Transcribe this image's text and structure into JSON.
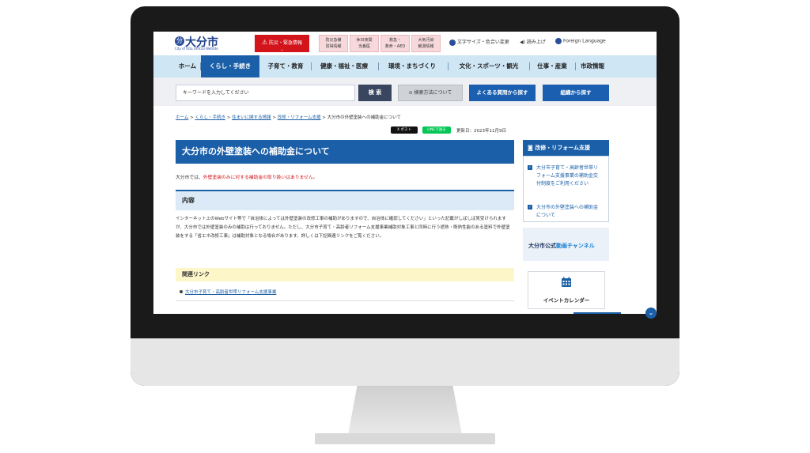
{
  "header": {
    "logo_mark": "分",
    "site_name": "大分市",
    "site_sub": "City of Oita Official Website",
    "alert_label": "防災・緊急情報",
    "alert_chevron": "⌄",
    "pink_buttons": [
      {
        "line1": "防災急備",
        "line2": "習得情報"
      },
      {
        "line1": "休日夜間",
        "line2": "当番医"
      },
      {
        "line1": "救急・",
        "line2": "救命・AED"
      },
      {
        "line1": "大気汚染",
        "line2": "観測情報"
      }
    ],
    "util_links": {
      "text_size": "文字サイズ・色合い変更",
      "read_aloud": "読み上げ",
      "language": "Foreign Language"
    }
  },
  "nav": {
    "items": [
      "ホーム",
      "くらし・手続き",
      "子育て・教育",
      "健康・福祉・医療",
      "環境・まちづくり",
      "文化・スポーツ・観光",
      "仕事・産業",
      "市政情報"
    ],
    "active_index": 1
  },
  "search": {
    "placeholder": "キーワードを入力してください",
    "search_button": "検 索",
    "how_to_button": "⊙ 検索方法について",
    "faq_button": "よくある質問から探す",
    "org_button": "組織から探す"
  },
  "breadcrumb": {
    "items": [
      "ホーム",
      "くらし・手続き",
      "住まいに関する情報",
      "改修・リフォーム支援"
    ],
    "current": "大分市の外壁塗装への補助金について",
    "separator": " > "
  },
  "share": {
    "x_post": "X ポスト",
    "line_send": "LINEで送る",
    "updated": "更新日：2023年11月9日"
  },
  "page": {
    "title": "大分市の外壁塗装への補助金について",
    "note_prefix": "大分市では、",
    "note_red": "外壁塗装のみに対する補助金の取り扱いはありません。",
    "section_heading": "内容",
    "body": "インターネット上のWebサイト等で「自治体によっては外壁塗装の改修工事の補助がありますので、自治体に確認してください」といった記載がしばしば見受けられますが、大分市では外壁塗装のみの補助は行っておりません。ただし、大分市子育て・高齢者リフォーム支援事業補助対象工事と同時に行う遮熱・断熱性能のある塗料で外壁塗装をする「省エネ改修工事」は補助対象となる場合があります。詳しくは下記関連リンクをご覧ください。",
    "related_heading": "関連リンク",
    "related_link": "大分市子育て・高齢者世帯リフォーム支援事業"
  },
  "sidebar": {
    "heading": "改修・リフォーム支援",
    "links": [
      "大分市子育て・高齢者世帯リフォーム支援事業の補助金交付制度をご利用ください",
      "大分市の外壁塗装への補助金について"
    ],
    "channel_prefix": "大分市公式",
    "channel_blue": "動画チャンネル",
    "event_label": "イベントカレンダー"
  },
  "colors": {
    "brand_blue": "#1b5fa8",
    "alert_red": "#d3141b",
    "nav_bg": "#cfe6f4"
  }
}
